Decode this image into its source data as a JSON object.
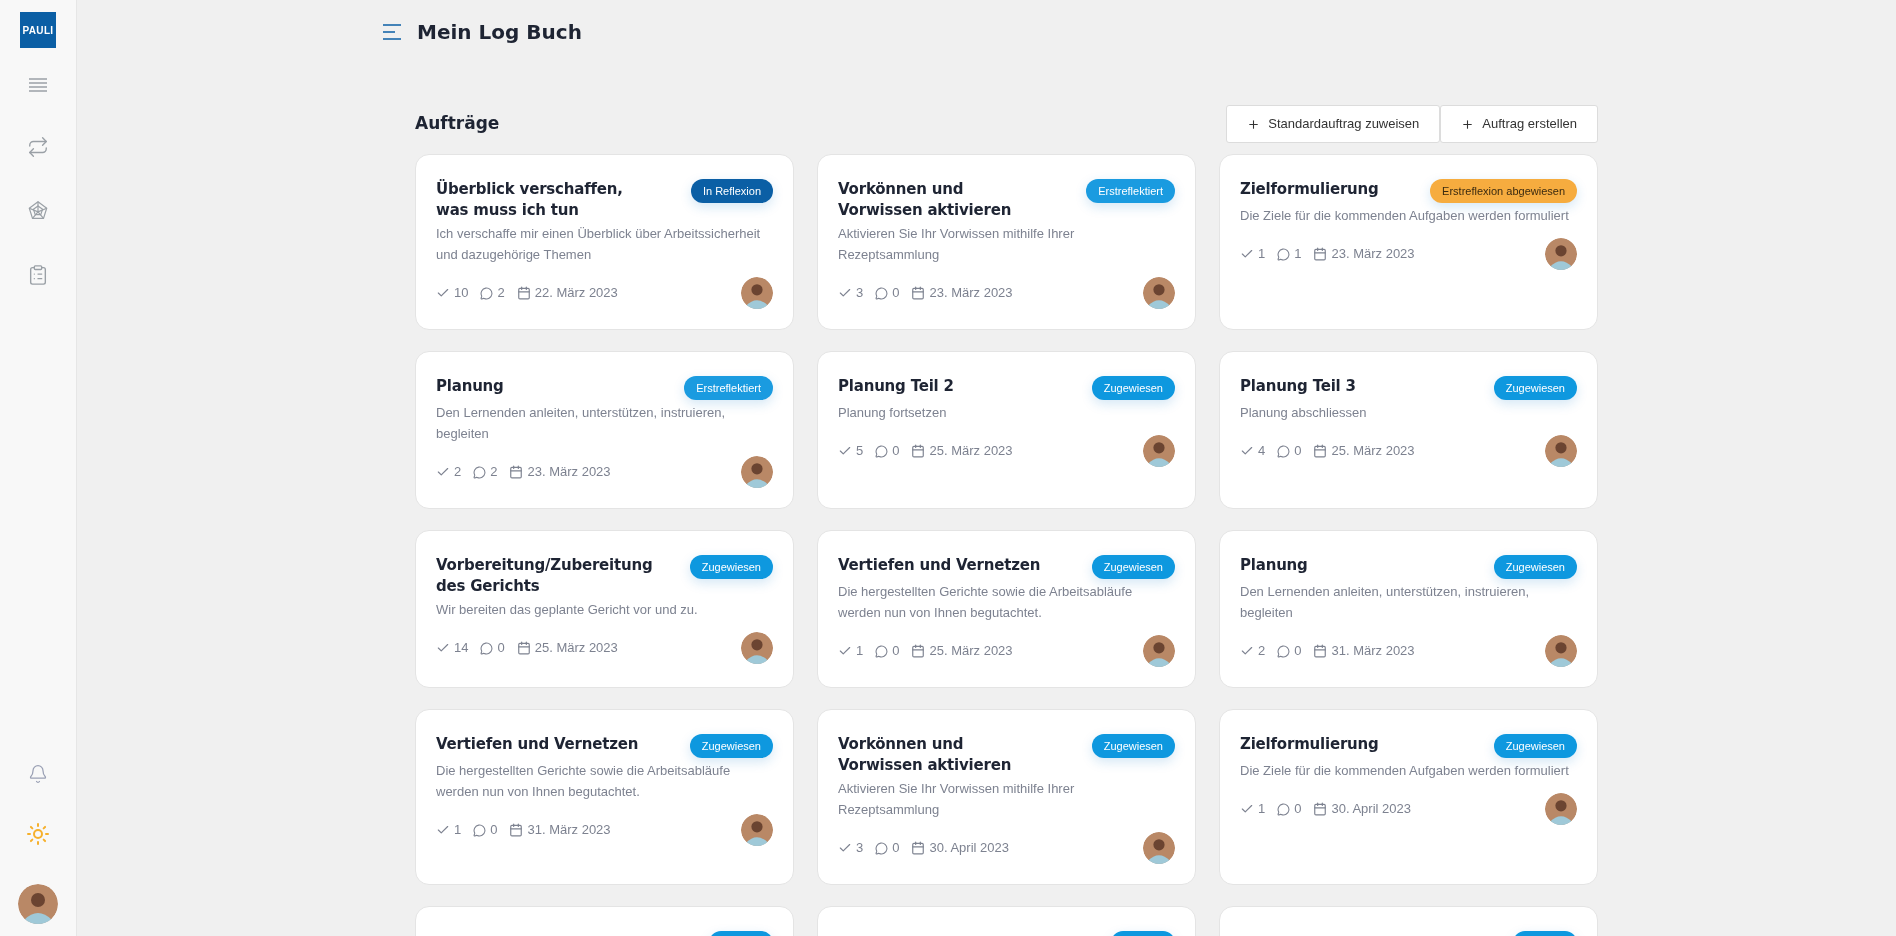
{
  "sidebar": {
    "logo": "PAULI"
  },
  "header": {
    "title": "Mein Log Buch"
  },
  "section": {
    "title": "Aufträge",
    "buttons": [
      {
        "label": "Standardauftrag zuweisen"
      },
      {
        "label": "Auftrag erstellen"
      }
    ]
  },
  "cards": [
    {
      "title": "Überblick verschaffen,\nwas muss ich tun",
      "kind": "reflection",
      "badge": "In Reflexion",
      "description": "Ich verschaffe mir einen Überblick über Arbeitssicherheit und dazugehörige Themen",
      "checks": "10",
      "comments": "2",
      "date": "22. März 2023"
    },
    {
      "title": "Vorkönnen und\nVorwissen aktivieren",
      "kind": "first_reflected",
      "badge": "Erstreflektiert",
      "description": "Aktivieren Sie Ihr Vorwissen mithilfe Ihrer Rezeptsammlung",
      "checks": "3",
      "comments": "0",
      "date": "23. März 2023"
    },
    {
      "title": "Zielformulierung",
      "kind": "rejected",
      "badge": "Erstreflexion abgewiesen",
      "description": "Die Ziele für die kommenden Aufgaben werden formuliert",
      "checks": "1",
      "comments": "1",
      "date": "23. März 2023"
    },
    {
      "title": "Planung",
      "kind": "first_reflected",
      "badge": "Erstreflektiert",
      "description": "Den Lernenden anleiten, unterstützen, instruieren, begleiten",
      "checks": "2",
      "comments": "2",
      "date": "23. März 2023"
    },
    {
      "title": "Planung Teil 2",
      "kind": "assigned",
      "badge": "Zugewiesen",
      "description": "Planung fortsetzen",
      "checks": "5",
      "comments": "0",
      "date": "25. März 2023"
    },
    {
      "title": "Planung Teil 3",
      "kind": "assigned",
      "badge": "Zugewiesen",
      "description": "Planung abschliessen",
      "checks": "4",
      "comments": "0",
      "date": "25. März 2023"
    },
    {
      "title": "Vorbereitung/Zubereitung\ndes Gerichts",
      "kind": "assigned",
      "badge": "Zugewiesen",
      "description": "Wir bereiten das geplante Gericht vor und zu.",
      "checks": "14",
      "comments": "0",
      "date": "25. März 2023"
    },
    {
      "title": "Vertiefen und Vernetzen",
      "kind": "assigned",
      "badge": "Zugewiesen",
      "description": "Die hergestellten Gerichte sowie die Arbeitsabläufe werden nun von Ihnen begutachtet.",
      "checks": "1",
      "comments": "0",
      "date": "25. März 2023"
    },
    {
      "title": "Planung",
      "kind": "assigned",
      "badge": "Zugewiesen",
      "description": "Den Lernenden anleiten, unterstützen, instruieren, begleiten",
      "checks": "2",
      "comments": "0",
      "date": "31. März 2023"
    },
    {
      "title": "Vertiefen und Vernetzen",
      "kind": "assigned",
      "badge": "Zugewiesen",
      "description": "Die hergestellten Gerichte sowie die Arbeitsabläufe werden nun von Ihnen begutachtet.",
      "checks": "1",
      "comments": "0",
      "date": "31. März 2023"
    },
    {
      "title": "Vorkönnen und\nVorwissen aktivieren",
      "kind": "assigned",
      "badge": "Zugewiesen",
      "description": "Aktivieren Sie Ihr Vorwissen mithilfe Ihrer Rezeptsammlung",
      "checks": "3",
      "comments": "0",
      "date": "30. April 2023"
    },
    {
      "title": "Zielformulierung",
      "kind": "assigned",
      "badge": "Zugewiesen",
      "description": "Die Ziele für die kommenden Aufgaben werden formuliert",
      "checks": "1",
      "comments": "0",
      "date": "30. April 2023"
    },
    {
      "kind": "assigned"
    },
    {
      "kind": "assigned"
    },
    {
      "kind": "assigned"
    }
  ]
}
